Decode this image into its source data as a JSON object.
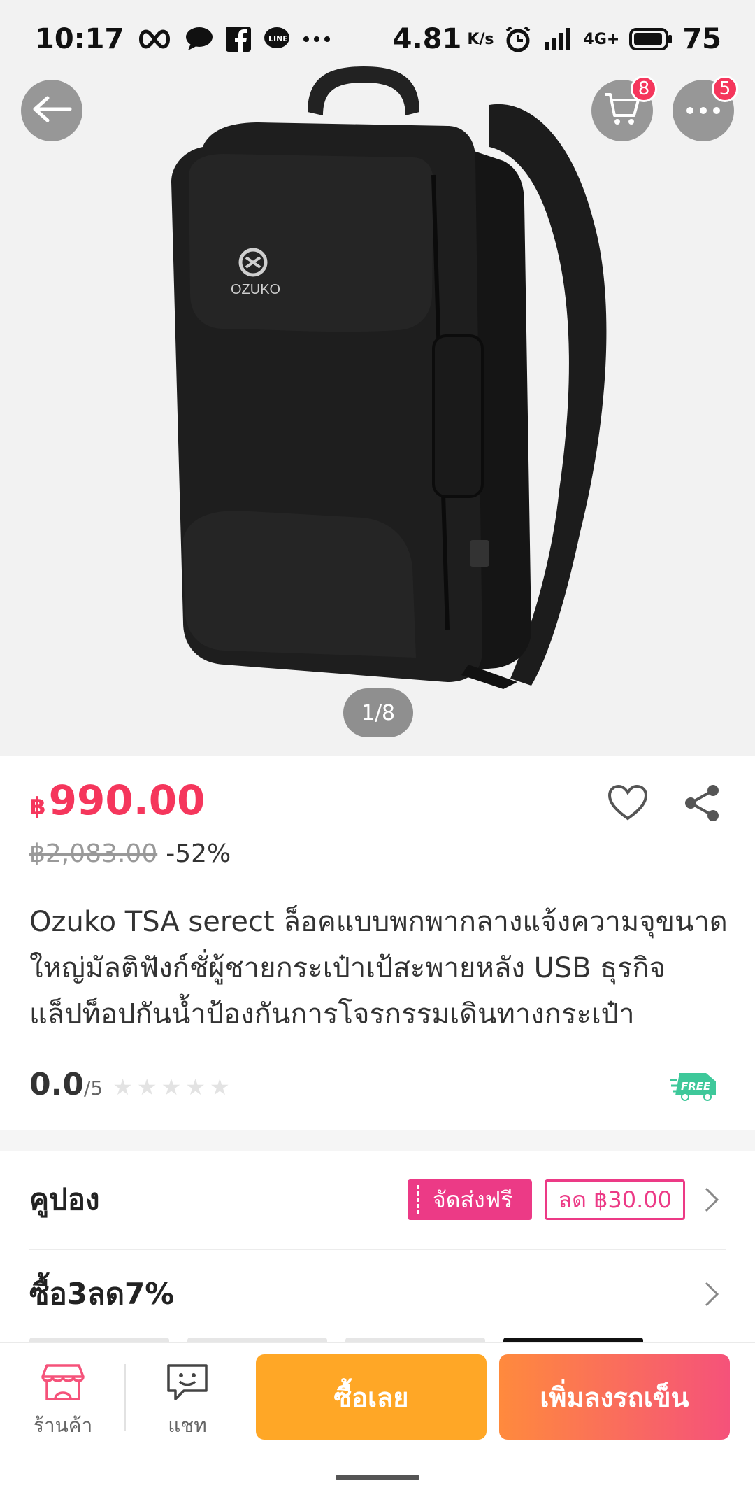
{
  "status_bar": {
    "time": "10:17",
    "speed": "4.81",
    "speed_unit": "K/s",
    "network": "4G+",
    "battery": "75",
    "icons": [
      "infinity-icon",
      "chat-bubble-icon",
      "facebook-icon",
      "line-icon",
      "more-dots-icon",
      "alarm-icon",
      "signal-icon",
      "battery-icon"
    ]
  },
  "header": {
    "back_icon": "arrow-left-icon",
    "cart_badge": "8",
    "more_badge": "5"
  },
  "gallery": {
    "brand": "OZUKO",
    "pager": "1/8"
  },
  "product": {
    "currency": "฿",
    "price": "990.00",
    "old_price": "฿2,083.00",
    "discount": "-52%",
    "title": "Ozuko TSA serect ล็อคแบบพกพากลางแจ้งความจุขนาดใหญ่มัลติฟังก์ชั่ผู้ชายกระเป๋าเป้สะพายหลัง USB ธุรกิจแล็ปท็อปกันน้ำป้องกันการโจรกรรมเดินทางกระเป๋า",
    "rating_value": "0.0",
    "rating_max": "/5",
    "free_shipping_tag": "FREE"
  },
  "coupon": {
    "label": "คูปอง",
    "free_ship": "จัดส่งฟรี",
    "discount": "ลด ฿30.00"
  },
  "promo": {
    "label": "ซื้อ3ลด7%"
  },
  "bottom_bar": {
    "shop_label": "ร้านค้า",
    "chat_label": "แชท",
    "buy_now": "ซื้อเลย",
    "add_to_cart": "เพิ่มลงรถเข็น"
  },
  "colors": {
    "accent": "#f5365c",
    "coupon": "#ec3a86",
    "buy_now": "#ffa726",
    "add_to_cart_start": "#ff8a3d",
    "add_to_cart_end": "#f5527a"
  }
}
